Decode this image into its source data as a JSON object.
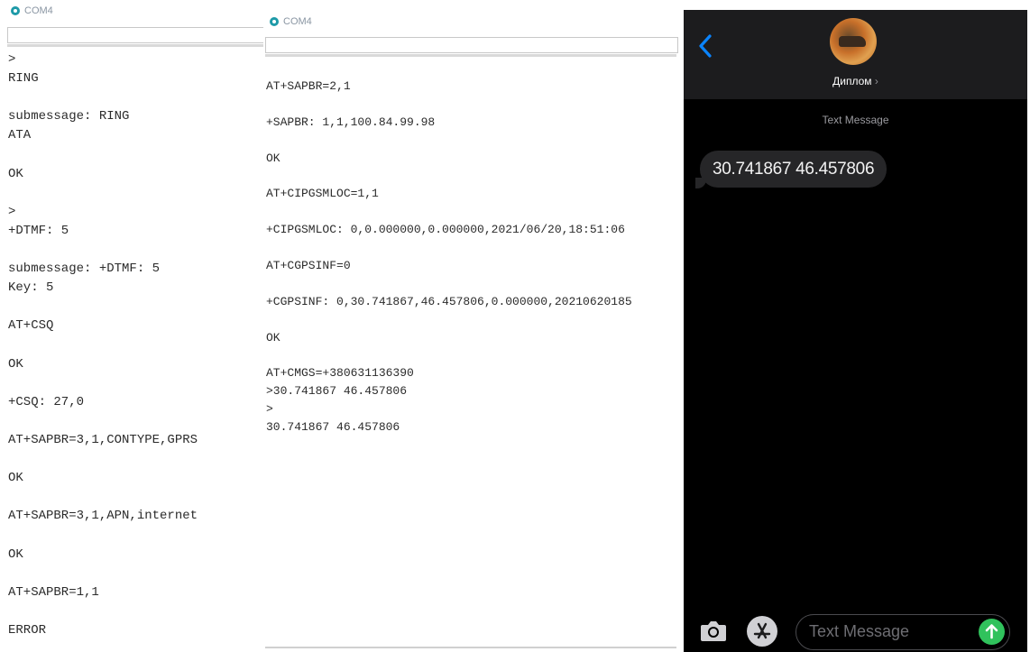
{
  "left_monitor": {
    "title": "COM4",
    "lines": [
      ">",
      "RING",
      "",
      "submessage: RING",
      "ATA",
      "",
      "OK",
      "",
      ">",
      "+DTMF: 5",
      "",
      "submessage: +DTMF: 5",
      "Key: 5",
      "",
      "AT+CSQ",
      "",
      "OK",
      "",
      "+CSQ: 27,0",
      "",
      "AT+SAPBR=3,1,CONTYPE,GPRS",
      "",
      "OK",
      "",
      "AT+SAPBR=3,1,APN,internet",
      "",
      "OK",
      "",
      "AT+SAPBR=1,1",
      "",
      "ERROR"
    ]
  },
  "right_monitor": {
    "title": "COM4",
    "lines": [
      "AT+SAPBR=2,1",
      "",
      "+SAPBR: 1,1,100.84.99.98",
      "",
      "OK",
      "",
      "AT+CIPGSMLOC=1,1",
      "",
      "+CIPGSMLOC: 0,0.000000,0.000000,2021/06/20,18:51:06",
      "",
      "AT+CGPSINF=0",
      "",
      "+CGPSINF: 0,30.741867,46.457806,0.000000,20210620185",
      "",
      "OK",
      "",
      "AT+CMGS=+380631136390",
      ">30.741867 46.457806",
      ">",
      "30.741867 46.457806"
    ]
  },
  "phone": {
    "contact_name": "Диплом",
    "contact_chevron": "›",
    "message_type_label": "Text Message",
    "messages": [
      "30.741867 46.457806"
    ],
    "input_placeholder": "Text Message",
    "colors": {
      "send": "#30c25c",
      "back": "#0a84ff"
    },
    "icons": [
      "back-chevron-icon",
      "camera-icon",
      "app-store-icon",
      "send-arrow-icon"
    ]
  }
}
